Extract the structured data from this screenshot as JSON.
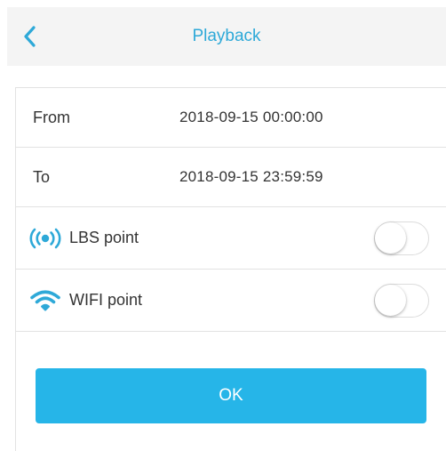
{
  "header": {
    "title": "Playback",
    "back_icon": "chevron-left-icon"
  },
  "form": {
    "from": {
      "label": "From",
      "value": "2018-09-15 00:00:00"
    },
    "to": {
      "label": "To",
      "value": "2018-09-15 23:59:59"
    },
    "lbs": {
      "label": "LBS point",
      "icon": "lbs-signal-icon",
      "enabled": false
    },
    "wifi": {
      "label": "WIFI point",
      "icon": "wifi-icon",
      "enabled": false
    }
  },
  "actions": {
    "ok_label": "OK"
  },
  "colors": {
    "accent": "#2ea9d8",
    "button": "#26b5e8",
    "header_bg": "#f4f4f4",
    "divider": "#e2e2e2"
  }
}
